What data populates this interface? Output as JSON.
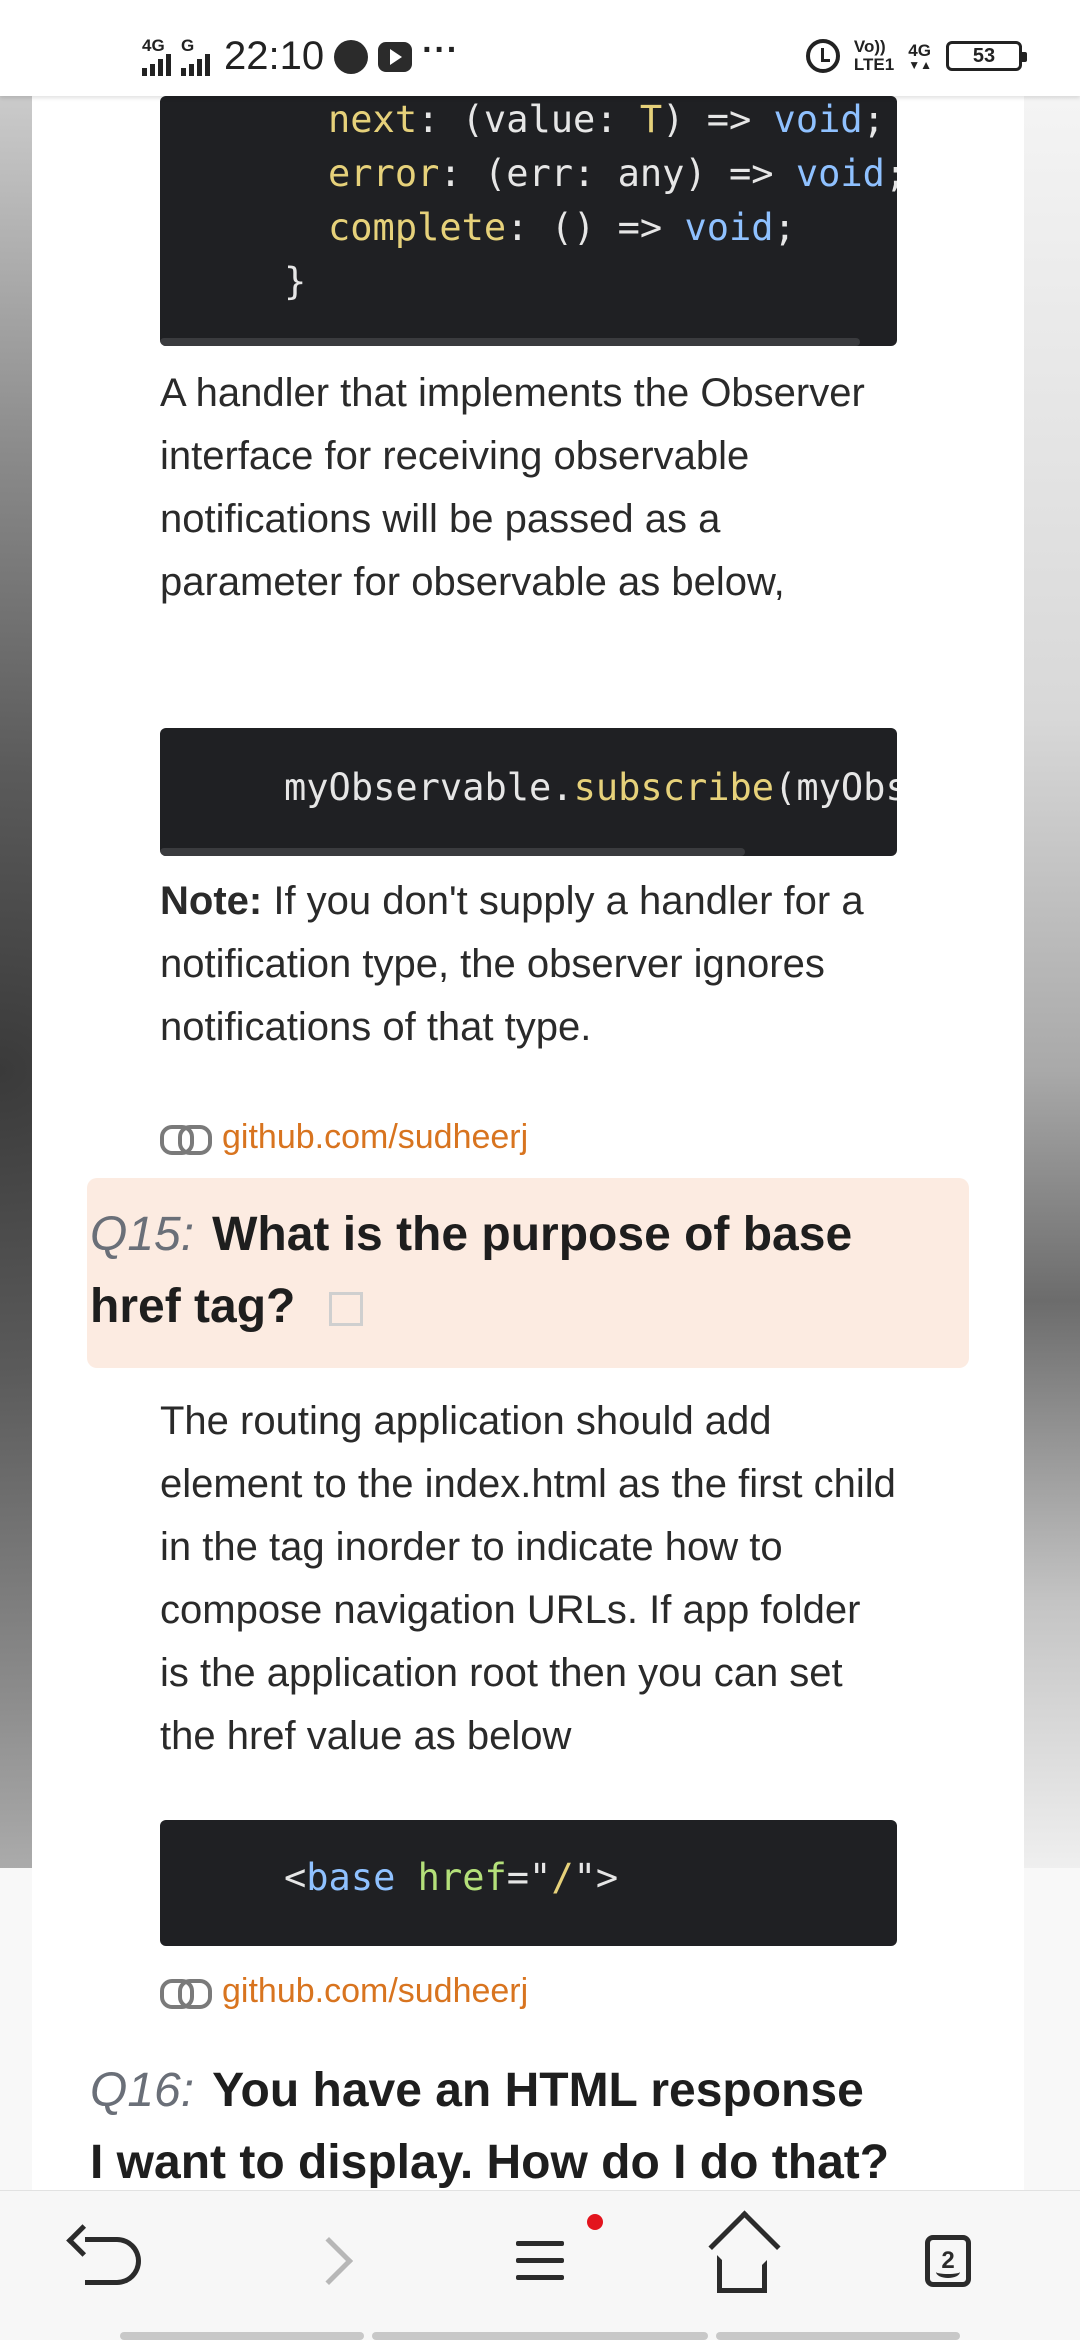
{
  "status_bar": {
    "network_1": "4G",
    "network_2": "G",
    "time": "22:10",
    "more": "···",
    "volte_top": "Vo))",
    "volte_bottom": "LTE1",
    "network_right": "4G",
    "battery": "53"
  },
  "code_top": {
    "lines": [
      {
        "key": "next",
        "sep": ": (value: ",
        "type": "T",
        "rest": ") => ",
        "ret": "void",
        "end": ";"
      },
      {
        "key": "error",
        "sep": ": (err: any) => ",
        "type": "",
        "rest": "",
        "ret": "void",
        "end": ";"
      },
      {
        "key": "complete",
        "sep": ": () => ",
        "type": "",
        "rest": "",
        "ret": "void",
        "end": ";"
      }
    ],
    "closing_brace": "}"
  },
  "para_1": "A handler that implements the Observer interface for receiving observable notifications will be passed as a parameter for observable as below,",
  "code_middle": {
    "object": "myObservable.",
    "method": "subscribe",
    "args": "(myObs"
  },
  "note": {
    "label": "Note:",
    "text": " If you don't supply a handler for a notification type, the observer ignores notifications of that type."
  },
  "link_1": "github.com/sudheerj",
  "q15": {
    "number": "Q15:",
    "line_1": "What is the purpose of base",
    "line_2": "href tag?"
  },
  "para_2": "The routing application should add element to the index.html as the first child in the tag inorder to indicate how to compose navigation URLs. If app folder is the application root then you can set the href value as below",
  "code_bottom": {
    "open": "<",
    "tag": "base",
    "attr": " href",
    "eq": "=\"",
    "val": "/",
    "close": "\">"
  },
  "link_2": "github.com/sudheerj",
  "q16": {
    "number": "Q16:",
    "line_1": "You have an HTML response",
    "line_2": "I want to display. How do I do that?"
  },
  "bottom_nav": {
    "tab_count": "2"
  }
}
